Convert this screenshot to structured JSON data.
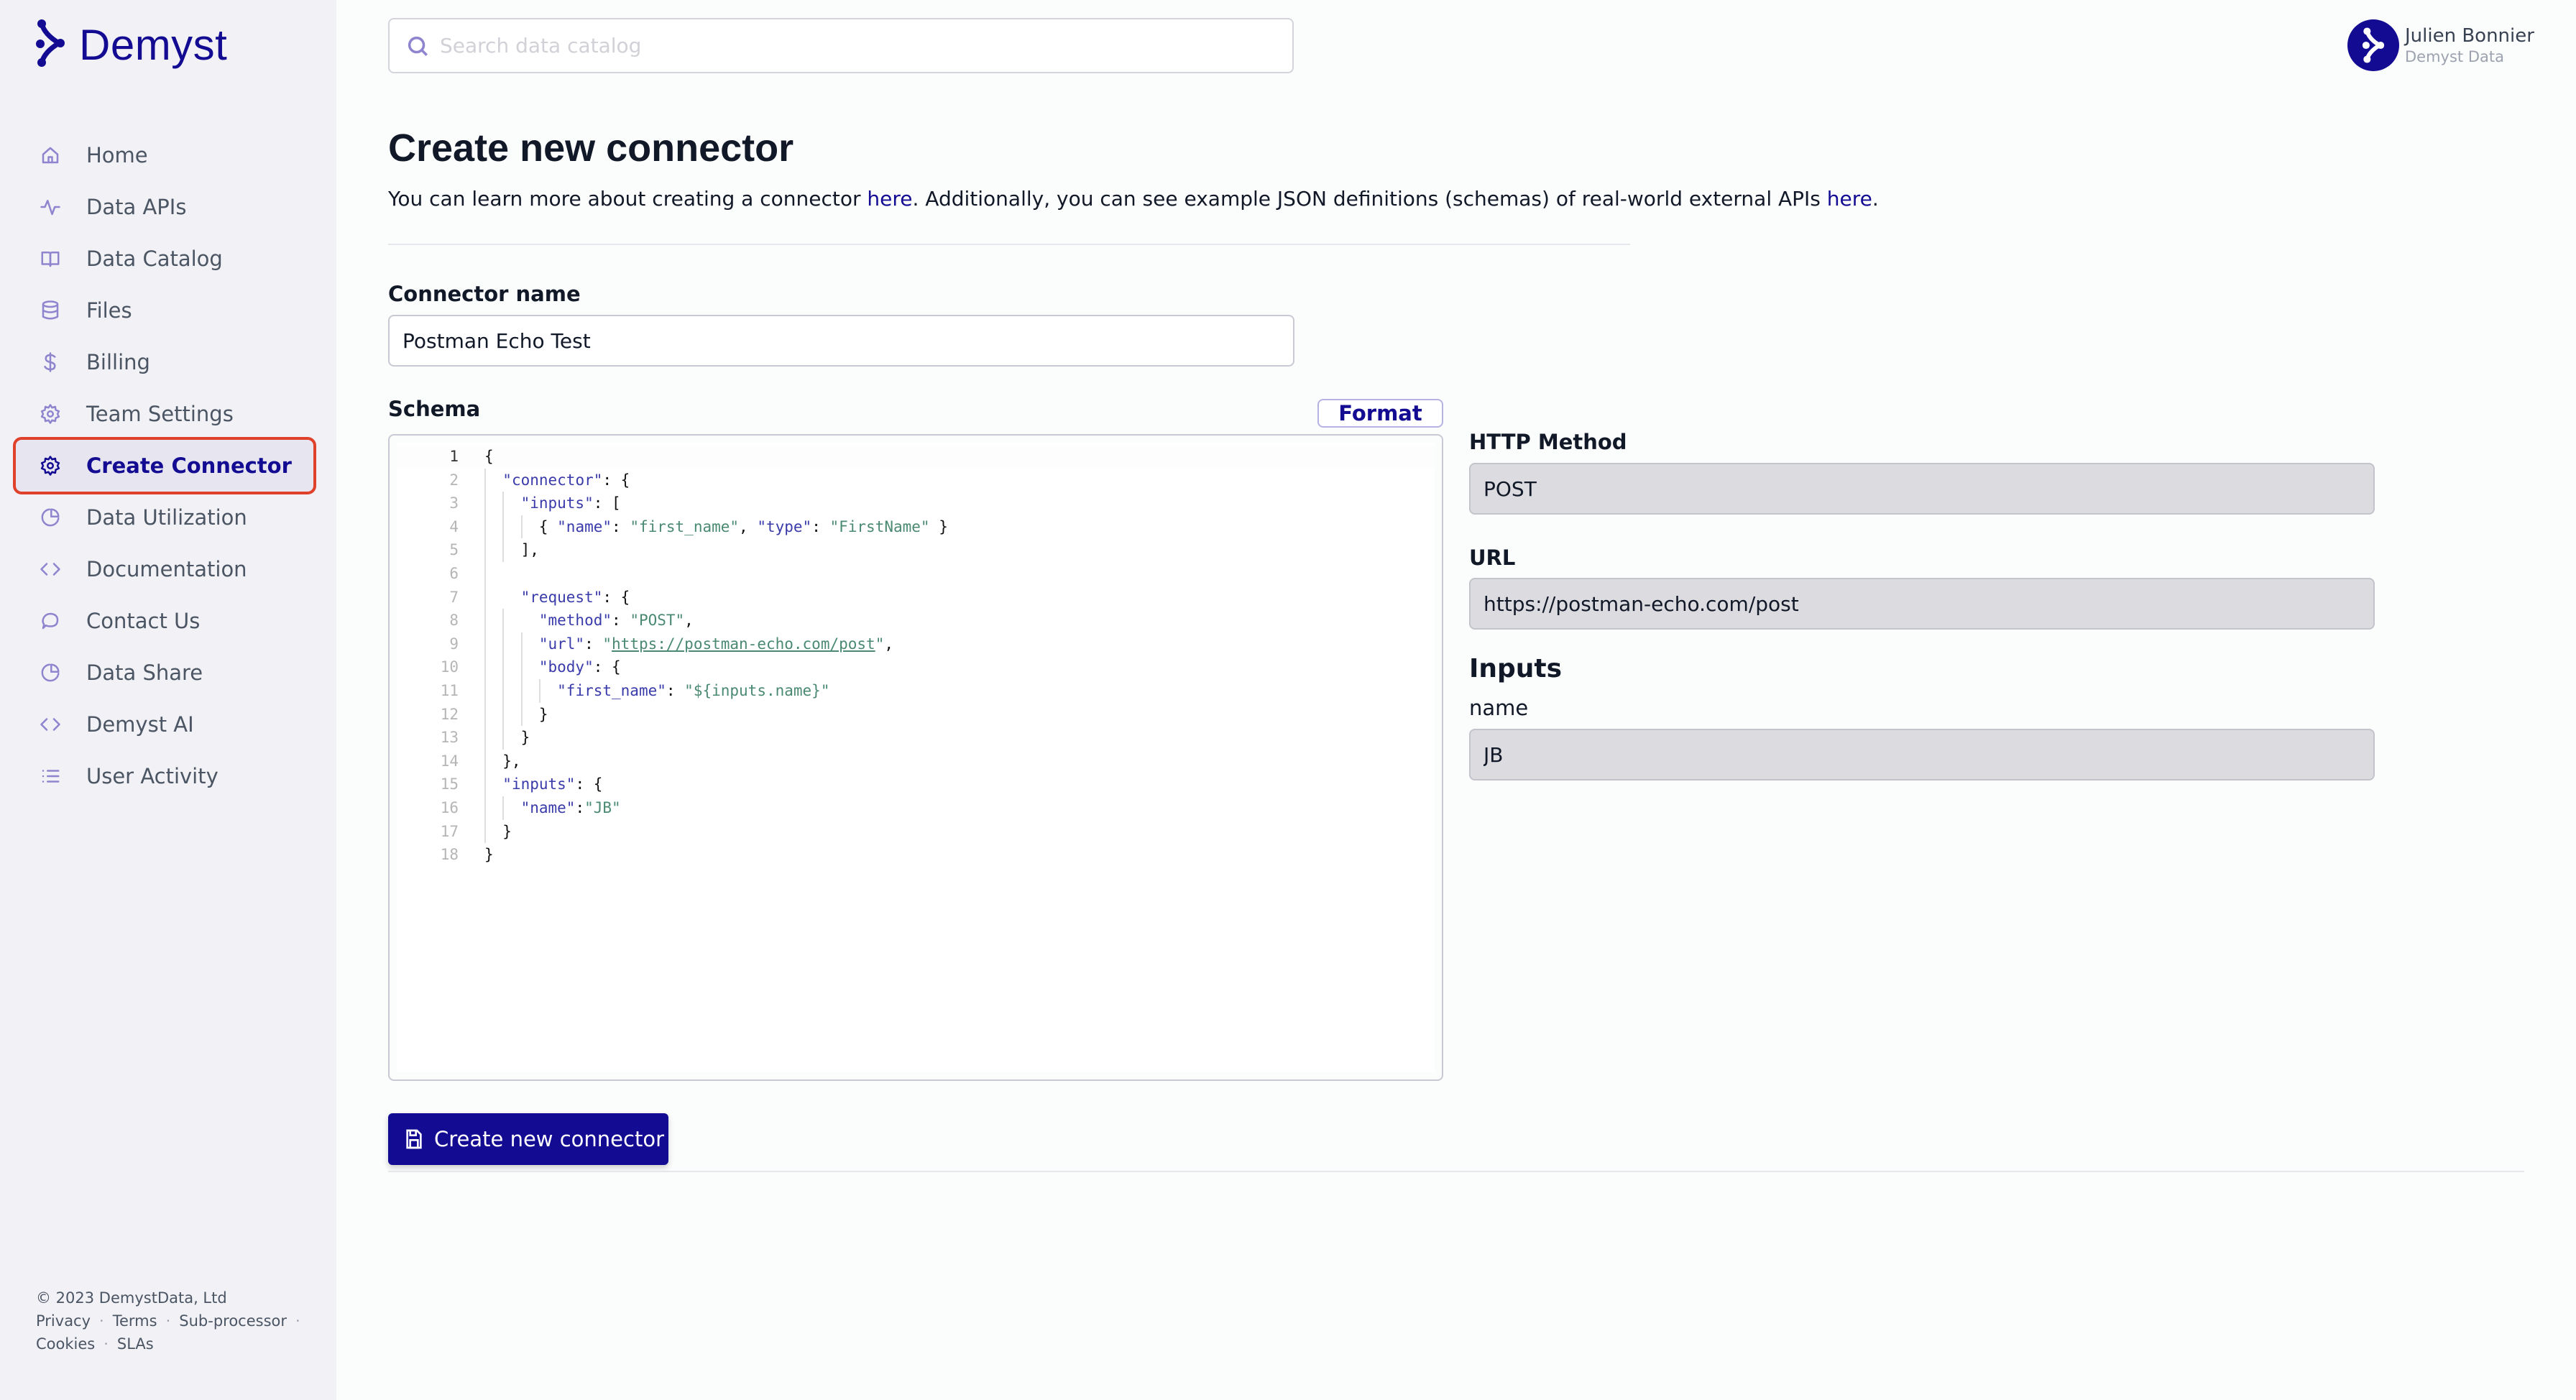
{
  "app": {
    "brand": "Demyst",
    "brand_color": "#130c93",
    "highlight_color": "#e0412b"
  },
  "sidebar": {
    "items": [
      {
        "label": "Home",
        "icon": "home-icon",
        "active": false
      },
      {
        "label": "Data APIs",
        "icon": "activity-icon",
        "active": false
      },
      {
        "label": "Data Catalog",
        "icon": "book-icon",
        "active": false
      },
      {
        "label": "Files",
        "icon": "database-icon",
        "active": false
      },
      {
        "label": "Billing",
        "icon": "dollar-icon",
        "active": false
      },
      {
        "label": "Team Settings",
        "icon": "gear-icon",
        "active": false
      },
      {
        "label": "Create Connector",
        "icon": "gear-icon",
        "active": true
      },
      {
        "label": "Data Utilization",
        "icon": "pie-chart-icon",
        "active": false
      },
      {
        "label": "Documentation",
        "icon": "code-icon",
        "active": false
      },
      {
        "label": "Contact Us",
        "icon": "chat-icon",
        "active": false
      },
      {
        "label": "Data Share",
        "icon": "pie-chart-icon",
        "active": false
      },
      {
        "label": "Demyst AI",
        "icon": "code-icon",
        "active": false
      },
      {
        "label": "User Activity",
        "icon": "list-icon",
        "active": false
      }
    ],
    "footer": {
      "copyright": "© 2023 DemystData, Ltd",
      "links": [
        "Privacy",
        "Terms",
        "Sub-processor",
        "Cookies",
        "SLAs"
      ]
    }
  },
  "header": {
    "search_placeholder": "Search data catalog",
    "search_value": "",
    "user_name": "Julien Bonnier",
    "user_org": "Demyst Data"
  },
  "main": {
    "title": "Create new connector",
    "desc_part1": "You can learn more about creating a connector ",
    "desc_link1": "here",
    "desc_part2": ". Additionally, you can see example JSON definitions (schemas) of real-world external APIs ",
    "desc_link2": "here",
    "desc_part3": ".",
    "connector_name_label": "Connector name",
    "connector_name_value": "Postman Echo Test",
    "schema_label": "Schema",
    "format_button": "Format",
    "schema_lines": [
      "{",
      "  \"connector\": {",
      "    \"inputs\": [",
      "      { \"name\": \"first_name\", \"type\": \"FirstName\" }",
      "    ],",
      "",
      "    \"request\": {",
      "      \"method\": \"POST\",",
      "      \"url\": \"https://postman-echo.com/post\",",
      "      \"body\": {",
      "        \"first_name\": \"${inputs.name}\"",
      "      }",
      "    }",
      "  },",
      "  \"inputs\": {",
      "    \"name\":\"JB\"",
      "  }",
      "}"
    ],
    "active_line": 1,
    "http_method_label": "HTTP Method",
    "http_method_value": "POST",
    "url_label": "URL",
    "url_value": "https://postman-echo.com/post",
    "inputs_heading": "Inputs",
    "input_name_label": "name",
    "input_name_value": "JB",
    "submit_button": "Create new connector"
  }
}
